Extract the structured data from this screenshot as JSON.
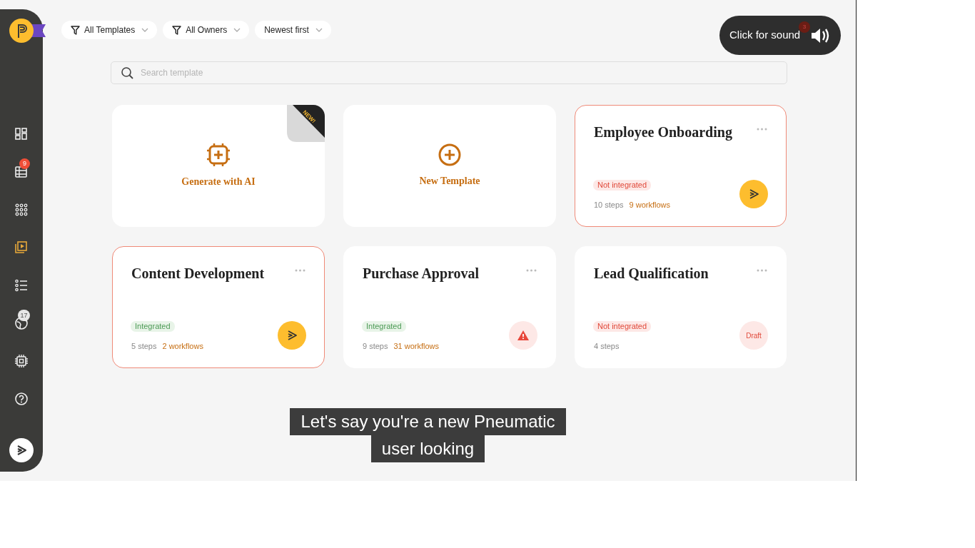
{
  "sidebar": {
    "items": [
      {
        "kind": "dashboard",
        "selected": false
      },
      {
        "kind": "tasks",
        "selected": false,
        "badge": "9"
      },
      {
        "kind": "grid",
        "selected": false
      },
      {
        "kind": "templates",
        "selected": true
      },
      {
        "kind": "list",
        "selected": false
      },
      {
        "kind": "globe",
        "selected": false,
        "badge": "17"
      },
      {
        "kind": "chip",
        "selected": false
      },
      {
        "kind": "help",
        "selected": false
      }
    ]
  },
  "filters": [
    {
      "label": "All Templates",
      "filter": true
    },
    {
      "label": "All Owners",
      "filter": true
    },
    {
      "label": "Newest first",
      "filter": false
    }
  ],
  "search": {
    "placeholder": "Search template"
  },
  "sound_button": {
    "label": "Click for sound",
    "badge": "3"
  },
  "cards": [
    {
      "kind": "ai",
      "label": "Generate with AI",
      "ribbon": "NEW!"
    },
    {
      "kind": "new",
      "label": "New Template"
    },
    {
      "kind": "template",
      "title": "Employee Onboarding",
      "highlighted": true,
      "integrated": false,
      "status": "Not integrated",
      "steps": "10 steps",
      "workflows": "9 workflows",
      "action": {
        "kind": "run"
      }
    },
    {
      "kind": "template",
      "title": "Content Development",
      "highlighted": true,
      "integrated": true,
      "status": "Integrated",
      "steps": "5 steps",
      "workflows": "2 workflows",
      "action": {
        "kind": "run"
      }
    },
    {
      "kind": "template",
      "title": "Purchase Approval",
      "highlighted": false,
      "integrated": true,
      "status": "Integrated",
      "steps": "9 steps",
      "workflows": "31 workflows",
      "action": {
        "kind": "warning"
      }
    },
    {
      "kind": "template",
      "title": "Lead Qualification",
      "highlighted": false,
      "integrated": false,
      "status": "Not integrated",
      "steps": "4 steps",
      "action": {
        "kind": "draft",
        "label": "Draft"
      }
    }
  ],
  "captions": [
    "Let's say you're a new Pneumatic",
    "user looking"
  ]
}
